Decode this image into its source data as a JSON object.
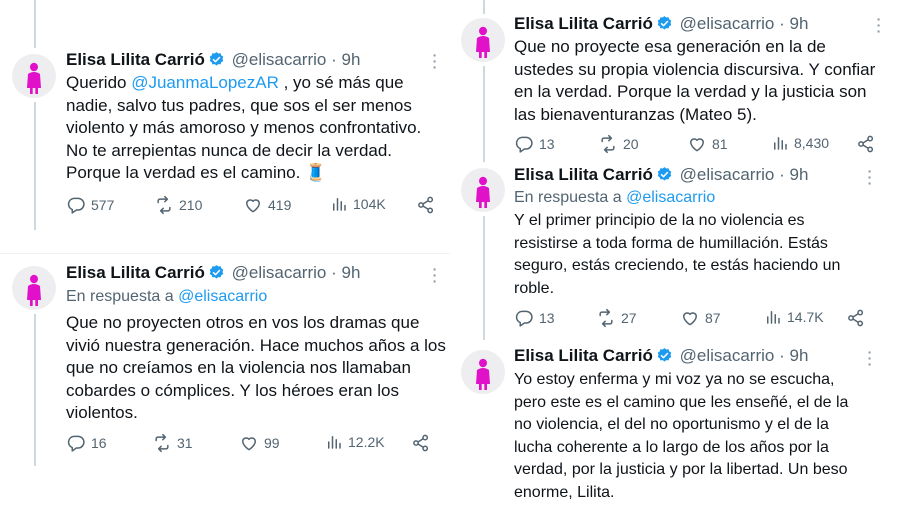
{
  "colors": {
    "accent": "#1d9bf0",
    "avatar_figure": "#e011c9",
    "secondary_text": "#536471"
  },
  "author": {
    "name": "Elisa Lilita Carrió",
    "handle": "@elisacarrio",
    "time": "9h",
    "dot": "·"
  },
  "reply_prefix": "En respuesta a",
  "reply_handle": "@elisacarrio",
  "tweets": [
    {
      "mention": "@JuanmaLopezAR",
      "text_pre": "Querido ",
      "text_post": " , yo sé más que nadie, salvo tus padres, que sos el ser menos violento y más amoroso y menos confrontativo. No te arrepientas nunca de decir la verdad. Porque la verdad es el camino.",
      "emoji": "🧵",
      "replies": "577",
      "retweets": "210",
      "likes": "419",
      "views": "104K"
    },
    {
      "text": "Que no proyecten otros en vos los dramas que vivió nuestra generación. Hace muchos años a los que no creíamos en la violencia nos llamaban cobardes o cómplices. Y los héroes eran los violentos.",
      "replies": "16",
      "retweets": "31",
      "likes": "99",
      "views": "12.2K"
    },
    {
      "text": "Que no proyecte esa generación en la de ustedes su propia violencia discursiva. Y confiar en la verdad. Porque la verdad y la justicia son las bienaventuranzas (Mateo 5).",
      "replies": "13",
      "retweets": "20",
      "likes": "81",
      "views": "8,430"
    },
    {
      "text": "Y el primer principio de la no violencia es resistirse a toda forma de humillación. Estás seguro, estás creciendo, te estás haciendo un roble.",
      "replies": "13",
      "retweets": "27",
      "likes": "87",
      "views": "14.7K"
    },
    {
      "text": "Yo estoy enferma y mi voz ya no se escucha, pero este es el camino que les enseñé, el de la no violencia, el del no oportunismo y el de la lucha coherente a lo largo de los años por la verdad, por la justicia y por la libertad. Un beso enorme, Lilita."
    }
  ]
}
